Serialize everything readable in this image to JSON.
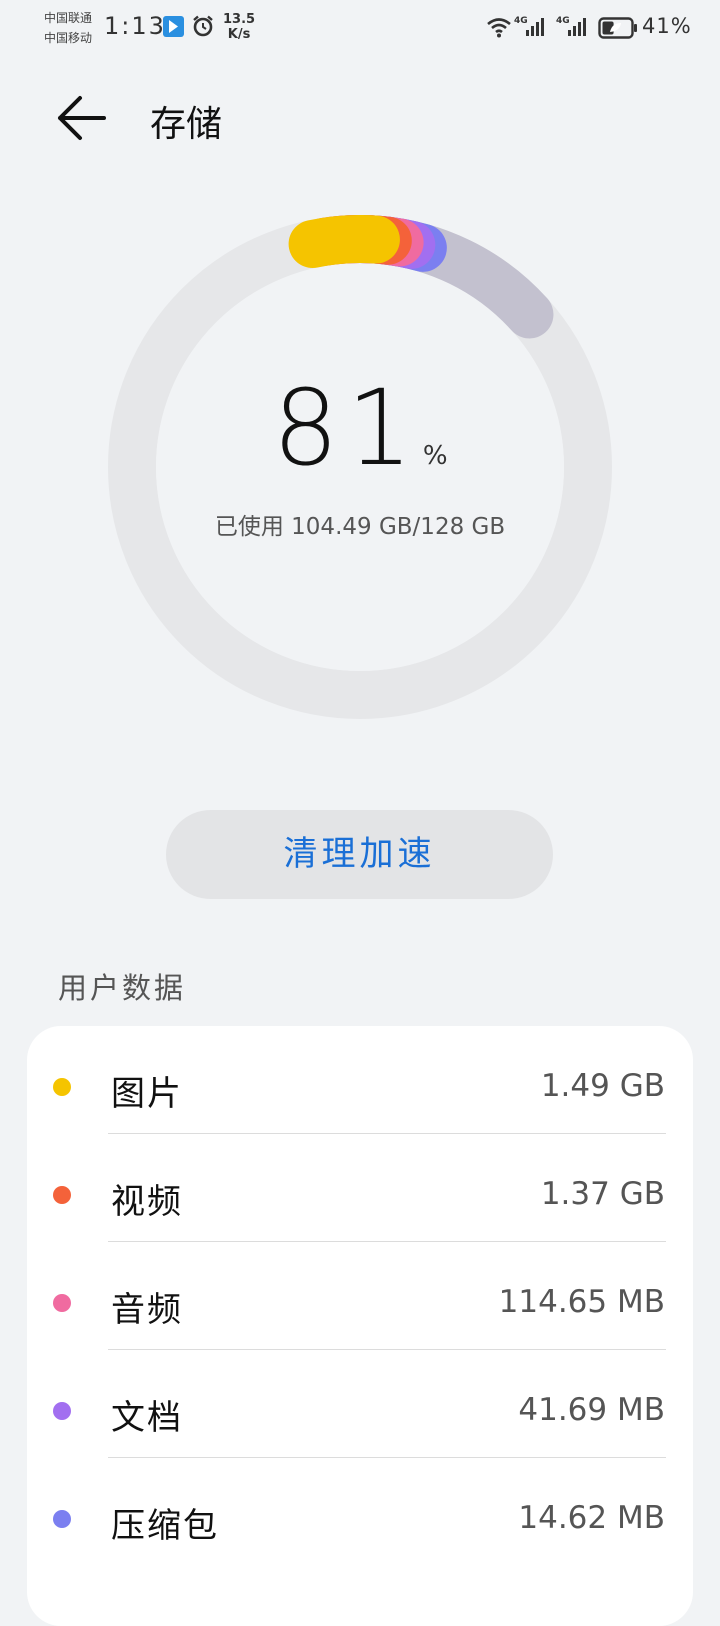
{
  "status_bar": {
    "carrier_1": "中国联通",
    "carrier_2": "中国移动",
    "time": "1:13",
    "speed_value": "13.5",
    "speed_unit": "K/s",
    "network_1": "4G",
    "network_2": "4G",
    "battery": "41%",
    "battery_level": 0.41
  },
  "header": {
    "title": "存储"
  },
  "storage": {
    "percent": "81",
    "percent_sign": "%",
    "used_text": "已使用 104.49 GB/128 GB",
    "used_fraction": 0.81
  },
  "clean_button": {
    "label": "清理加速"
  },
  "section": {
    "title": "用户数据"
  },
  "categories": [
    {
      "label": "图片",
      "value": "1.49 GB",
      "color": "#f5c400"
    },
    {
      "label": "视频",
      "value": "1.37 GB",
      "color": "#f4623a"
    },
    {
      "label": "音频",
      "value": "114.65 MB",
      "color": "#f06ba0"
    },
    {
      "label": "文档",
      "value": "41.69 MB",
      "color": "#a26ff0"
    },
    {
      "label": "压缩包",
      "value": "14.62 MB",
      "color": "#7b7ff0"
    }
  ],
  "colors": {
    "ring_track": "#e6e7e9",
    "ring_used": "#c3c1cf",
    "accent": "#1a6fd6",
    "background": "#f1f3f5"
  }
}
